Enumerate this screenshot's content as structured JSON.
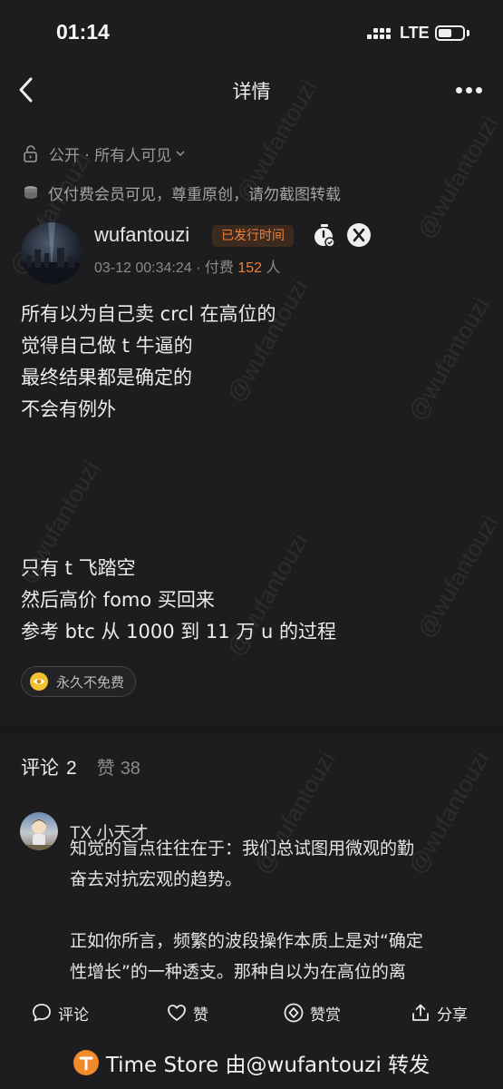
{
  "status_bar": {
    "time": "01:14",
    "network": "LTE",
    "battery_level": 0.55
  },
  "nav": {
    "title": "详情"
  },
  "visibility": {
    "label": "公开 · 所有人可见"
  },
  "paid_notice": {
    "text": "仅付费会员可见，尊重原创，请勿截图转载"
  },
  "author": {
    "name": "wufantouzi",
    "badge": "已发行时间",
    "timestamp": "03-12 00:34:24",
    "paid_prefix": "· 付费",
    "paid_count": "152",
    "paid_suffix": "人"
  },
  "post": {
    "lines": [
      "所有以为自己卖 crcl 在高位的",
      "觉得自己做 t 牛逼的",
      "最终结果都是确定的",
      "不会有例外",
      "",
      "",
      "",
      "",
      "只有 t 飞踏空",
      "然后高价 fomo 买回来",
      "参考 btc 从 1000 到 11 万 u 的过程"
    ],
    "tag": "永久不免费"
  },
  "comments": {
    "title": "评论",
    "count": "2",
    "likes_label": "赞",
    "likes_count": "38",
    "items": [
      {
        "author": "TX 小天才",
        "lines": [
          "知觉的盲点往往在于：我们总试图用微观的勤",
          "奋去对抗宏观的趋势。",
          "",
          "正如你所言，频繁的波段操作本质上是对“确定",
          "性增长”的一种透支。那种自以为在高位的离"
        ]
      }
    ]
  },
  "actions": {
    "comment": "评论",
    "like": "赞",
    "reward": "赞赏",
    "share": "分享"
  },
  "footer": {
    "text": "Time Store 由@wufantouzi 转发"
  },
  "watermark": {
    "text": "@wufantouzi"
  },
  "colors": {
    "accent": "#f0803a",
    "background": "#1d1d1f"
  }
}
